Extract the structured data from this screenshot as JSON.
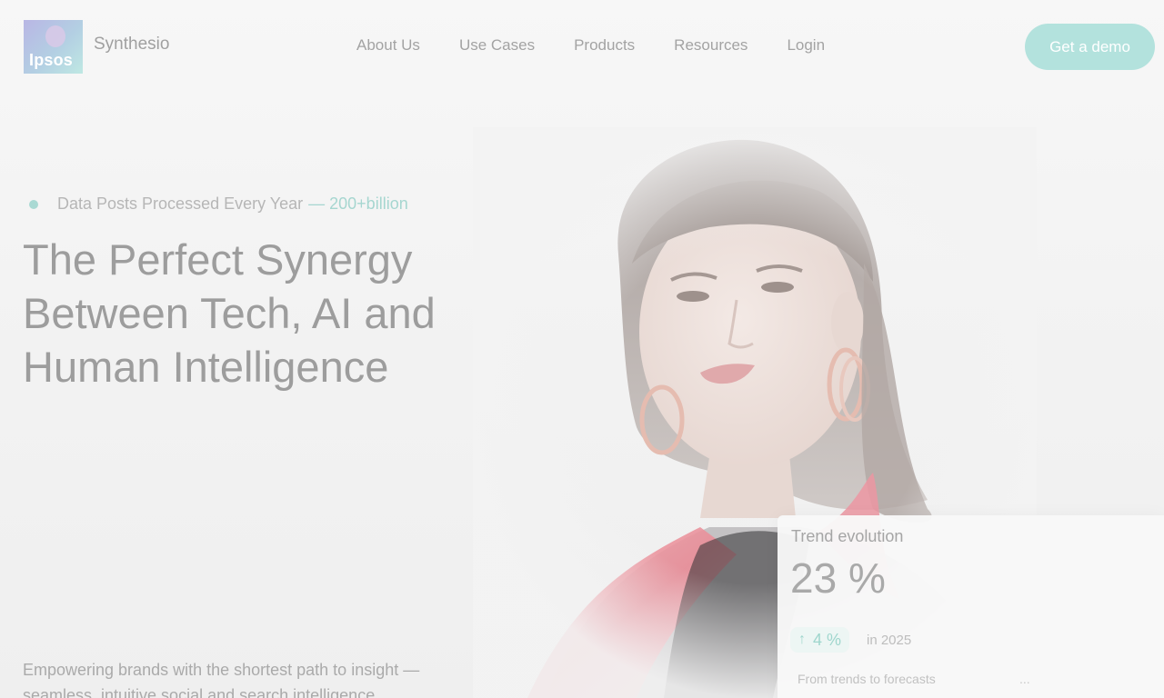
{
  "brand": {
    "logo_text": "Ipsos",
    "name": "Synthesio"
  },
  "nav": {
    "items": [
      {
        "label": "About Us"
      },
      {
        "label": "Use Cases"
      },
      {
        "label": "Products"
      },
      {
        "label": "Resources"
      },
      {
        "label": "Login"
      }
    ],
    "cta_label": "Get a demo"
  },
  "hero": {
    "eyebrow_text": "Data Posts Processed Every Year",
    "eyebrow_accent": "— 200+billion",
    "title_lines": [
      "The Perfect Synergy",
      "Between Tech, AI and",
      "Human Intelligence"
    ],
    "subtitle_lines": [
      "Empowering brands with the shortest path to insight —",
      "seamless, intuitive social and search intelligence."
    ]
  },
  "trend_card": {
    "title": "Trend evolution",
    "value": "23 %",
    "change": "4 %",
    "change_icon": "arrow-up-icon",
    "period": "in 2025",
    "footer": "From trends to forecasts",
    "more": "..."
  },
  "colors": {
    "accent": "#b3e2dd",
    "accent_text": "#a6d6d0",
    "heading": "#9d9d9d",
    "nav_text": "#a3a3a3"
  }
}
